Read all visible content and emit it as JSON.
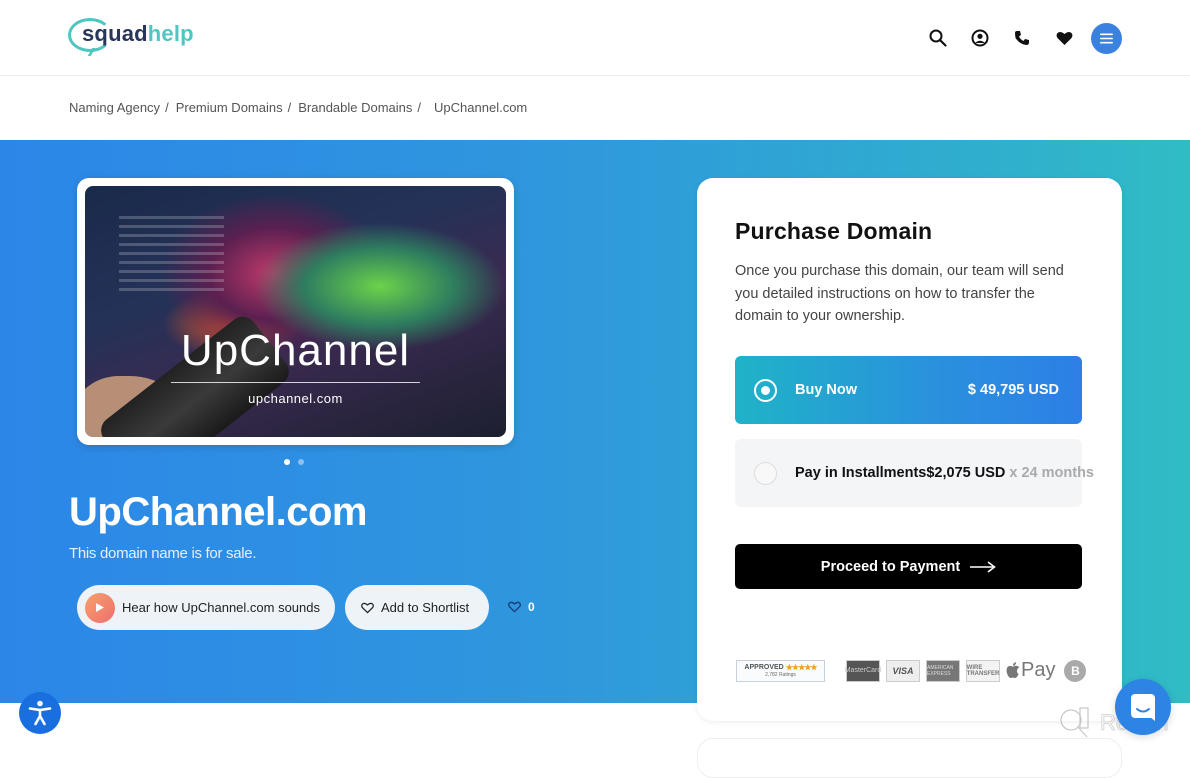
{
  "header": {
    "logo": {
      "part1": "squad",
      "part2": "help"
    },
    "icons": [
      "search-icon",
      "user-icon",
      "phone-icon",
      "heart-icon",
      "menu-icon"
    ]
  },
  "breadcrumb": {
    "items": [
      "Naming Agency",
      "Premium Domains",
      "Brandable Domains"
    ],
    "separator": "/",
    "current": "UpChannel.com"
  },
  "hero": {
    "image": {
      "title": "UpChannel",
      "subtitle": "upchannel.com",
      "slides": 2,
      "active_slide": 1
    },
    "domain_name": "UpChannel.com",
    "tagline": "This domain name is for sale.",
    "hear_button": "Hear how UpChannel.com sounds",
    "shortlist_button": "Add to Shortlist",
    "like_count": "0"
  },
  "purchase": {
    "title": "Purchase Domain",
    "description": "Once you purchase this domain, our team will send you detailed instructions on how to transfer the domain to your ownership.",
    "options": [
      {
        "label": "Buy Now",
        "price": "$ 49,795 USD",
        "selected": true
      },
      {
        "label": "Pay in Installments",
        "price": "$2,075 USD",
        "suffix": " x 24 months",
        "selected": false
      }
    ],
    "proceed_button": "Proceed to Payment",
    "payment_methods": {
      "shopper_approved": {
        "label": "APPROVED",
        "stars": "★★★★★",
        "ratings": "2,782 Ratings"
      },
      "cards": [
        "MasterCard",
        "VISA",
        "AMERICAN EXPRESS",
        "WIRE TRANSFER"
      ],
      "apple_pay": "Pay",
      "bitcoin": "B"
    }
  },
  "colors": {
    "brand_dark": "#28365a",
    "brand_teal": "#4fc6c0",
    "accent_blue": "#2d84e5",
    "hero_gradient_start": "#2c86e8",
    "hero_gradient_end": "#30bcc5"
  },
  "watermark": {
    "text": "Revain"
  }
}
